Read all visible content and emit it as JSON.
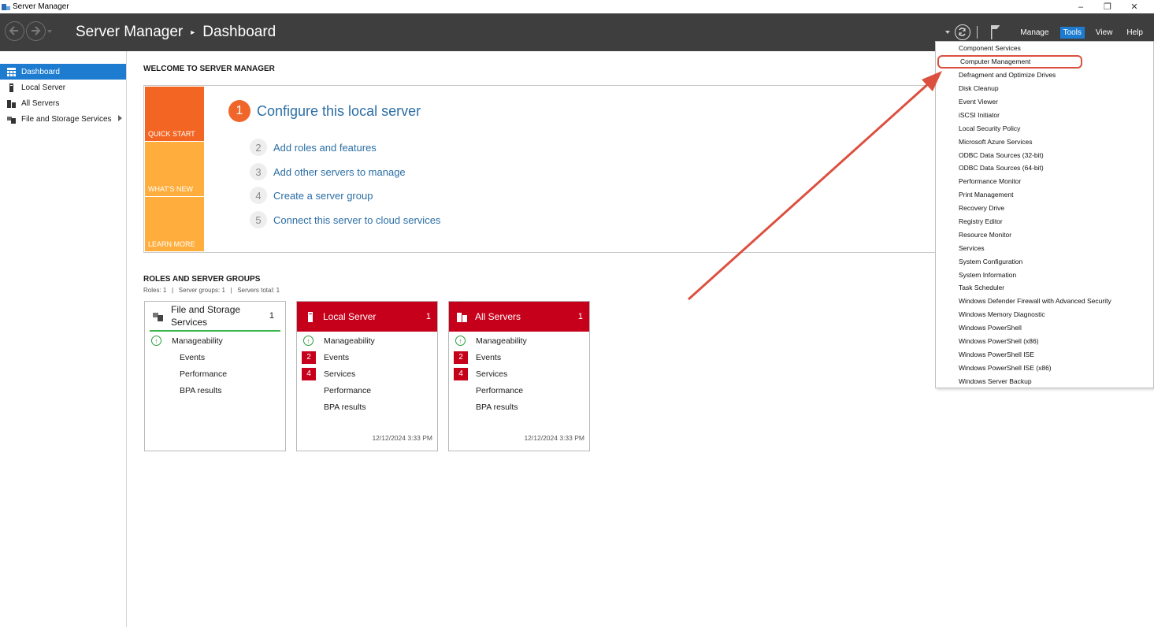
{
  "window": {
    "title": "Server Manager",
    "controls": {
      "minimize": "–",
      "restore": "❐",
      "close": "✕"
    }
  },
  "header": {
    "breadcrumb_root": "Server Manager",
    "breadcrumb_separator": "▸",
    "breadcrumb_current": "Dashboard",
    "menus": {
      "manage": "Manage",
      "tools": "Tools",
      "view": "View",
      "help": "Help"
    },
    "active_menu": "Tools",
    "accent_color": "#1e7cd0"
  },
  "sidebar": {
    "items": [
      {
        "label": "Dashboard",
        "icon": "dashboard-icon",
        "active": true
      },
      {
        "label": "Local Server",
        "icon": "server-icon"
      },
      {
        "label": "All Servers",
        "icon": "servers-icon"
      },
      {
        "label": "File and Storage Services",
        "icon": "storage-icon",
        "has_submenu": true
      }
    ]
  },
  "welcome": {
    "title": "WELCOME TO SERVER MANAGER",
    "tiles": {
      "quick_start": "QUICK START",
      "whats_new": "WHAT'S NEW",
      "learn_more": "LEARN MORE"
    },
    "tile_colors": {
      "quick_start": "#f26522",
      "whats_new": "#ffae3d",
      "learn_more": "#ffae3d"
    },
    "steps": [
      {
        "num": "1",
        "label": "Configure this local server"
      },
      {
        "num": "2",
        "label": "Add roles and features"
      },
      {
        "num": "3",
        "label": "Add other servers to manage"
      },
      {
        "num": "4",
        "label": "Create a server group"
      },
      {
        "num": "5",
        "label": "Connect this server to cloud services"
      }
    ]
  },
  "roles": {
    "title": "ROLES AND SERVER GROUPS",
    "subtitle": "Roles: 1   |   Server groups: 1   |   Servers total: 1",
    "cards": [
      {
        "title": "File and Storage Services",
        "count": "1",
        "rows": {
          "manageability": "Manageability",
          "events": "Events",
          "performance": "Performance",
          "bpa": "BPA results"
        }
      },
      {
        "title": "Local Server",
        "count": "1",
        "rows": {
          "manageability": "Manageability",
          "events": "Events",
          "services": "Services",
          "performance": "Performance",
          "bpa": "BPA results"
        },
        "badges": {
          "events": "2",
          "services": "4"
        },
        "timestamp": "12/12/2024 3:33 PM"
      },
      {
        "title": "All Servers",
        "count": "1",
        "rows": {
          "manageability": "Manageability",
          "events": "Events",
          "services": "Services",
          "performance": "Performance",
          "bpa": "BPA results"
        },
        "badges": {
          "events": "2",
          "services": "4"
        },
        "timestamp": "12/12/2024 3:33 PM"
      }
    ],
    "alert_color": "#c6001a",
    "ok_color": "#3ab54a"
  },
  "tools_menu": {
    "items": [
      "Component Services",
      "Computer Management",
      "Defragment and Optimize Drives",
      "Disk Cleanup",
      "Event Viewer",
      "iSCSI Initiator",
      "Local Security Policy",
      "Microsoft Azure Services",
      "ODBC Data Sources (32-bit)",
      "ODBC Data Sources (64-bit)",
      "Performance Monitor",
      "Print Management",
      "Recovery Drive",
      "Registry Editor",
      "Resource Monitor",
      "Services",
      "System Configuration",
      "System Information",
      "Task Scheduler",
      "Windows Defender Firewall with Advanced Security",
      "Windows Memory Diagnostic",
      "Windows PowerShell",
      "Windows PowerShell (x86)",
      "Windows PowerShell ISE",
      "Windows PowerShell ISE (x86)",
      "Windows Server Backup"
    ],
    "highlighted": "Computer Management",
    "highlight_color": "#dc5040"
  }
}
